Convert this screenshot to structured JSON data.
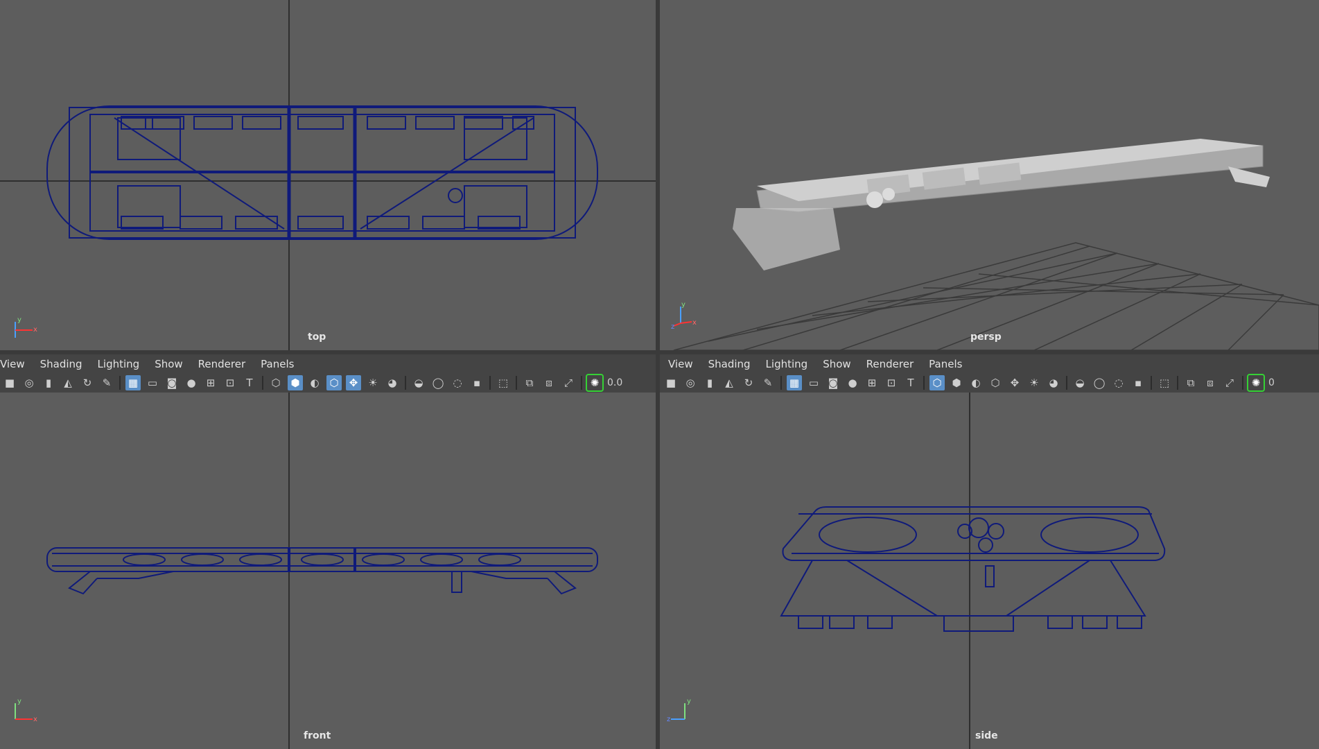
{
  "viewports": {
    "top": {
      "label": "top"
    },
    "persp": {
      "label": "persp"
    },
    "front": {
      "label": "front"
    },
    "side": {
      "label": "side"
    }
  },
  "menus": {
    "left": [
      "View",
      "Shading",
      "Lighting",
      "Show",
      "Renderer",
      "Panels"
    ],
    "right": [
      "View",
      "Shading",
      "Lighting",
      "Show",
      "Renderer",
      "Panels"
    ]
  },
  "toolbar": {
    "left_value": "0.0",
    "right_value": "0"
  },
  "axes": {
    "top": {
      "y": "y",
      "x": "x"
    },
    "persp": {
      "y": "y",
      "x": "x",
      "z": "z"
    },
    "front": {
      "y": "y",
      "x": "x"
    },
    "side": {
      "y": "y",
      "z": "z"
    }
  },
  "colors": {
    "viewport_bg": "#5d5d5d",
    "wireframe": "#0f1a7a",
    "grid_axis": "#2e2e2e",
    "panel_bg": "#444444",
    "active_button": "#5a8fc7"
  }
}
